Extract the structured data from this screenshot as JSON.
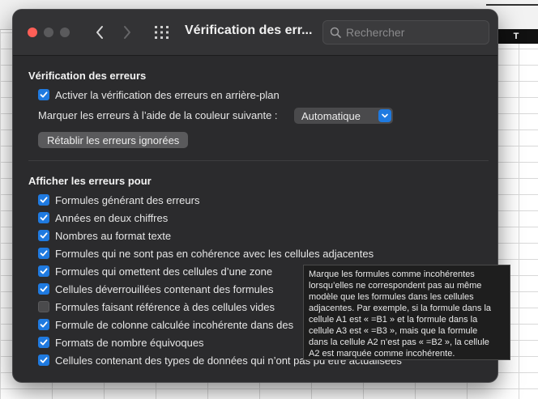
{
  "window": {
    "title": "Vérification des err...",
    "search_placeholder": "Rechercher"
  },
  "section_errors": {
    "title": "Vérification des erreurs",
    "background_check_label": "Activer la vérification des erreurs en arrière-plan",
    "background_check_checked": true,
    "color_label": "Marquer les erreurs à l’aide de la couleur suivante :",
    "color_value": "Automatique",
    "reset_button": "Rétablir les erreurs ignorées"
  },
  "section_show": {
    "title": "Afficher les erreurs pour",
    "items": [
      {
        "label": "Formules générant des erreurs",
        "checked": true
      },
      {
        "label": "Années en deux chiffres",
        "checked": true
      },
      {
        "label": "Nombres au format texte",
        "checked": true
      },
      {
        "label": "Formules qui ne sont pas en cohérence avec les cellules adjacentes",
        "checked": true
      },
      {
        "label": "Formules qui omettent des cellules d’une zone",
        "checked": true
      },
      {
        "label": "Cellules déverrouillées contenant des formules",
        "checked": true
      },
      {
        "label": "Formules faisant référence à des cellules vides",
        "checked": false
      },
      {
        "label": "Formule de colonne calculée incohérente dans des",
        "checked": true
      },
      {
        "label": "Formats de nombre équivoques",
        "checked": true
      },
      {
        "label": "Cellules contenant des types de données qui n’ont pas pu être actualisées",
        "checked": true
      }
    ]
  },
  "tooltip": {
    "lines": [
      "Marque les formules comme incohérentes",
      "lorsqu’elles ne correspondent pas au même",
      "modèle que les formules dans les cellules",
      "adjacentes. Par exemple, si la formule dans la",
      "cellule A1 est « =B1 » et la formule dans la",
      "cellule A3 est « =B3 », mais que la formule",
      "dans la cellule A2 n’est pas « =B2 », la cellule",
      "A2 est marquée comme incohérente."
    ]
  },
  "spreadsheet": {
    "column_header": "T"
  },
  "colors": {
    "accent": "#1f7ae0",
    "close_button": "#ff5f57",
    "dialog_bg": "#2b2b2d"
  }
}
